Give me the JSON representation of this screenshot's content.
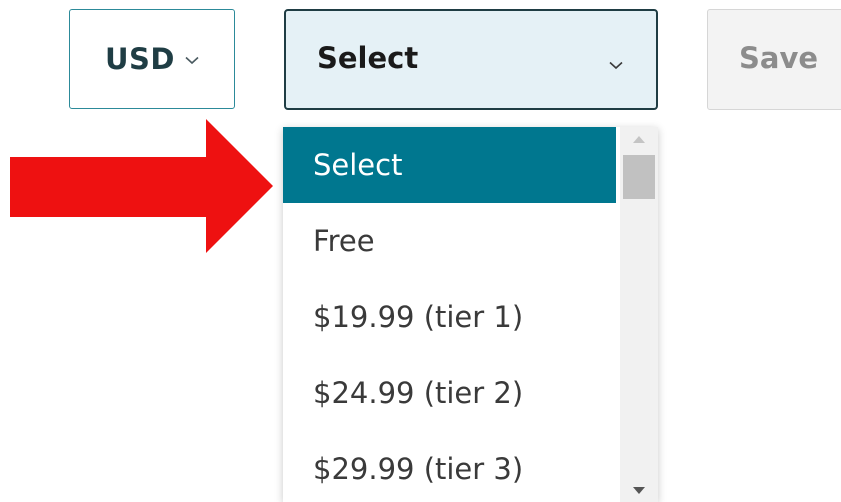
{
  "toolbar": {
    "currency_label": "USD",
    "price_select_label": "Select",
    "save_label": "Save"
  },
  "dropdown": {
    "options": [
      {
        "label": "Select",
        "selected": true
      },
      {
        "label": "Free",
        "selected": false
      },
      {
        "label": "$19.99 (tier 1)",
        "selected": false
      },
      {
        "label": "$24.99 (tier 2)",
        "selected": false
      },
      {
        "label": "$29.99 (tier 3)",
        "selected": false
      }
    ]
  },
  "icons": {
    "currency_chevron": "chevron-down-icon",
    "price_chevron": "chevron-down-icon",
    "scroll_up": "scroll-up-arrow-icon",
    "scroll_down": "scroll-down-arrow-icon",
    "annotation": "red-arrow-icon"
  },
  "colors": {
    "accent_teal": "#00778f",
    "currency_border": "#2c8a99",
    "select_background": "#e5f1f6",
    "annotation_red": "#ee1111",
    "disabled_text": "#8c8c8c"
  }
}
